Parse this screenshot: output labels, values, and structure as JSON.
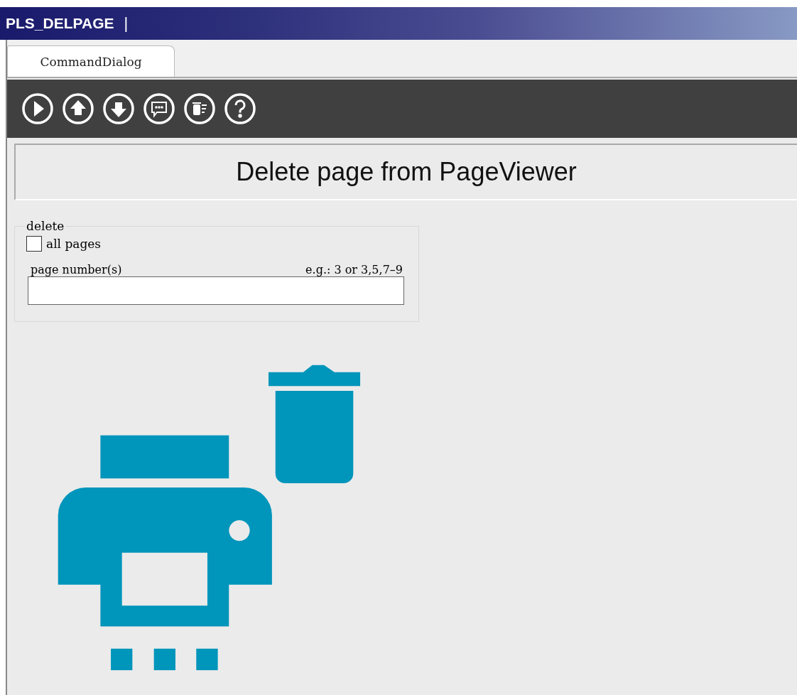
{
  "window": {
    "title": "PLS_DELPAGE",
    "caret": "|"
  },
  "tabs": [
    {
      "label": "CommandDialog",
      "selected": true
    }
  ],
  "toolbar": [
    {
      "kind": "play"
    },
    {
      "kind": "up"
    },
    {
      "kind": "down"
    },
    {
      "kind": "comment"
    },
    {
      "kind": "delete"
    },
    {
      "kind": "help"
    }
  ],
  "header": {
    "title": "Delete page from PageViewer"
  },
  "group": {
    "legend": "delete",
    "all_pages": {
      "label": "all pages",
      "checked": false
    },
    "page_numbers": {
      "label": "page number(s)",
      "hint": "e.g.: 3 or 3,5,7–9"
    }
  }
}
